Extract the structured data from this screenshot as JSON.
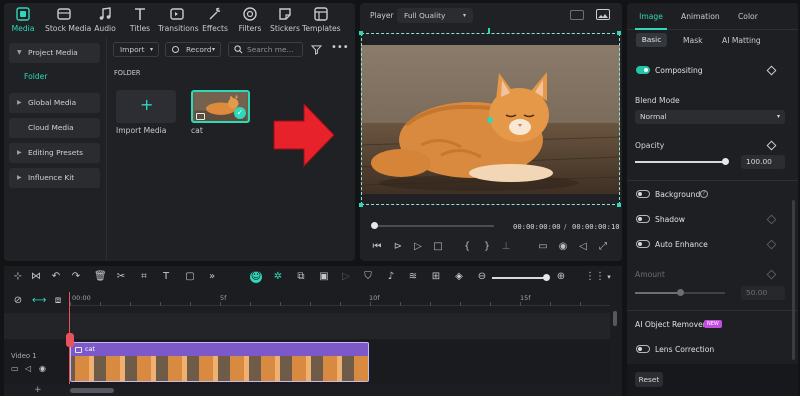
{
  "toolbar": {
    "items": [
      {
        "label": "Media",
        "icon": "media-icon"
      },
      {
        "label": "Stock Media",
        "icon": "stock-media-icon"
      },
      {
        "label": "Audio",
        "icon": "music-note-icon"
      },
      {
        "label": "Titles",
        "icon": "titles-icon"
      },
      {
        "label": "Transitions",
        "icon": "transitions-icon"
      },
      {
        "label": "Effects",
        "icon": "effects-icon"
      },
      {
        "label": "Filters",
        "icon": "filters-icon"
      },
      {
        "label": "Stickers",
        "icon": "stickers-icon"
      },
      {
        "label": "Templates",
        "icon": "templates-icon"
      }
    ]
  },
  "sidebar": {
    "project_media": "Project Media",
    "folder": "Folder",
    "items": [
      "Global Media",
      "Cloud Media",
      "Editing Presets",
      "Influence Kit"
    ]
  },
  "media": {
    "import_label": "Import",
    "record_label": "Record",
    "search_placeholder": "Search me...",
    "folder_heading": "FOLDER",
    "import_tile_label": "Import Media",
    "clip_name": "cat"
  },
  "player": {
    "label": "Player",
    "quality": "Full Quality",
    "current_time": "00:00:00:00",
    "separator": "/",
    "total_time": "00:00:00:10"
  },
  "properties": {
    "tabs": [
      "Image",
      "Animation",
      "Color"
    ],
    "subtabs": [
      "Basic",
      "Mask",
      "AI Matting"
    ],
    "compositing": "Compositing",
    "blend_mode_label": "Blend Mode",
    "blend_mode_value": "Normal",
    "opacity_label": "Opacity",
    "opacity_value": "100.00",
    "opacity_level": 1.0,
    "background": "Background",
    "shadow": "Shadow",
    "auto_enhance": "Auto Enhance",
    "amount_label": "Amount",
    "amount_value": "50.00",
    "amount_level": 0.5,
    "ai_object_remover": "AI Object Remover",
    "new_badge": "NEW",
    "lens_correction": "Lens Correction",
    "reset": "Reset"
  },
  "timeline": {
    "ruler": [
      "00:00",
      "5f",
      "10f",
      "15f"
    ],
    "track_label": "Video 1",
    "clip_label": "cat"
  },
  "colors": {
    "accent": "#2fd8b9",
    "clip": "#7d58c9",
    "playhead": "#e8525c",
    "arrow": "#e8222b"
  }
}
